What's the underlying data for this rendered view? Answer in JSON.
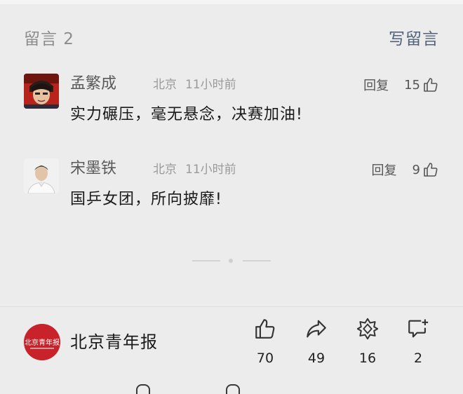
{
  "comments_section": {
    "count_label": "留言 2",
    "write_label": "写留言"
  },
  "comments": [
    {
      "author": "孟繁成",
      "location": "北京",
      "time": "11小时前",
      "text": "实力碾压，毫无悬念，决赛加油!",
      "reply_label": "回复",
      "likes": "15",
      "avatar": "anime-avatar"
    },
    {
      "author": "宋墨铁",
      "location": "北京",
      "time": "11小时前",
      "text": "国乒女团，所向披靡!",
      "reply_label": "回复",
      "likes": "9",
      "avatar": "person-avatar"
    }
  ],
  "footer": {
    "brand_name": "北京青年报",
    "brand_logo_text": "北京青年报",
    "actions": [
      {
        "icon": "thumbs-up-icon",
        "count": "70"
      },
      {
        "icon": "share-icon",
        "count": "49"
      },
      {
        "icon": "recommend-icon",
        "count": "16"
      },
      {
        "icon": "comment-icon",
        "count": "2"
      }
    ]
  },
  "colors": {
    "background": "#ececec",
    "link": "#52627c",
    "muted": "#9a9a9a",
    "brand_red": "#c8222a"
  }
}
